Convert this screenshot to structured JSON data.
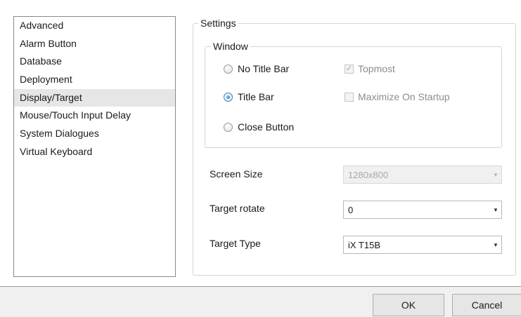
{
  "sidebar": {
    "items": [
      {
        "label": "Advanced"
      },
      {
        "label": "Alarm Button"
      },
      {
        "label": "Database"
      },
      {
        "label": "Deployment"
      },
      {
        "label": "Display/Target",
        "selected": true
      },
      {
        "label": "Mouse/Touch Input Delay"
      },
      {
        "label": "System Dialogues"
      },
      {
        "label": "Virtual Keyboard"
      }
    ]
  },
  "settings": {
    "legend": "Settings",
    "window": {
      "legend": "Window",
      "options": [
        {
          "label": "No Title Bar",
          "checked": false
        },
        {
          "label": "Title Bar",
          "checked": true
        },
        {
          "label": "Close Button",
          "checked": false
        }
      ],
      "topmost": {
        "label": "Topmost",
        "checked": true,
        "disabled": true
      },
      "maximize": {
        "label": "Maximize On Startup",
        "checked": false,
        "disabled": true
      }
    },
    "screen_size": {
      "label": "Screen Size",
      "value": "1280x800",
      "disabled": true
    },
    "target_rotate": {
      "label": "Target rotate",
      "value": "0"
    },
    "target_type": {
      "label": "Target Type",
      "value": "iX T15B"
    }
  },
  "footer": {
    "ok_label": "OK",
    "cancel_label": "Cancel"
  },
  "colors": {
    "selection": "#e6e6e6",
    "radio_accent": "#1f6bb0"
  }
}
